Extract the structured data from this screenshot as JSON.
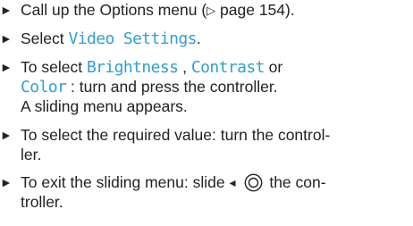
{
  "instructions": {
    "bullet": "►",
    "step1": {
      "before": "Call up the Options menu (",
      "page_ref_glyph": "▷",
      "page_ref": " page 154)."
    },
    "step2": {
      "before": "Select ",
      "menu_item": "Video Settings",
      "after": "."
    },
    "step3": {
      "before": "To select ",
      "item1": "Brightness",
      "sep1": " , ",
      "item2": "Contrast",
      "sep2": " or",
      "item3": "Color",
      "after": " : turn and press the controller.",
      "result": "A sliding menu appears."
    },
    "step4": {
      "line1": "To select the required value: turn the control-",
      "line2": "ler."
    },
    "step5": {
      "before": "To exit the sliding menu: slide ",
      "slide_arrow": "◂",
      "after": " the con-",
      "line2": "troller."
    }
  }
}
